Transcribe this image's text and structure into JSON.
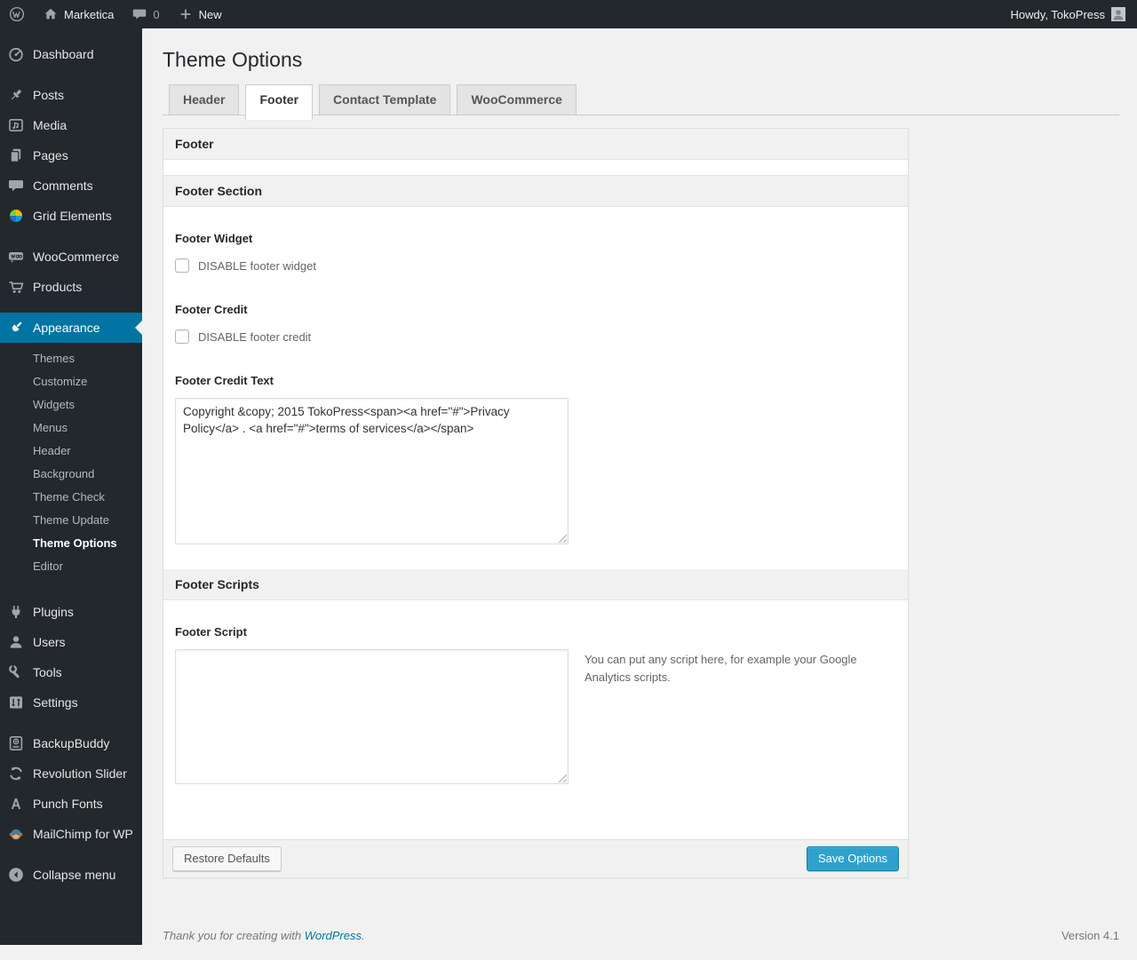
{
  "admin_bar": {
    "site_name": "Marketica",
    "comment_count": "0",
    "new_label": "New",
    "howdy": "Howdy, TokoPress"
  },
  "sidebar": {
    "items": [
      {
        "label": "Dashboard"
      },
      {
        "label": "Posts"
      },
      {
        "label": "Media"
      },
      {
        "label": "Pages"
      },
      {
        "label": "Comments"
      },
      {
        "label": "Grid Elements"
      },
      {
        "label": "WooCommerce"
      },
      {
        "label": "Products"
      },
      {
        "label": "Appearance",
        "active": true
      },
      {
        "label": "Plugins"
      },
      {
        "label": "Users"
      },
      {
        "label": "Tools"
      },
      {
        "label": "Settings"
      },
      {
        "label": "BackupBuddy"
      },
      {
        "label": "Revolution Slider"
      },
      {
        "label": "Punch Fonts"
      },
      {
        "label": "MailChimp for WP"
      },
      {
        "label": "Collapse menu"
      }
    ],
    "appearance_submenu": [
      "Themes",
      "Customize",
      "Widgets",
      "Menus",
      "Header",
      "Background",
      "Theme Check",
      "Theme Update",
      "Theme Options",
      "Editor"
    ],
    "current_submenu": "Theme Options"
  },
  "page": {
    "title": "Theme Options",
    "tabs": [
      {
        "label": "Header"
      },
      {
        "label": "Footer",
        "active": true
      },
      {
        "label": "Contact Template"
      },
      {
        "label": "WooCommerce"
      }
    ],
    "panel": {
      "header_title": "Footer",
      "section1_title": "Footer Section",
      "section2_title": "Footer Scripts",
      "footer_widget_label": "Footer Widget",
      "footer_widget_checkbox": "DISABLE footer widget",
      "footer_credit_label": "Footer Credit",
      "footer_credit_checkbox": "DISABLE footer credit",
      "footer_credit_text_label": "Footer Credit Text",
      "footer_credit_text_value": "Copyright &copy; 2015 TokoPress<span><a href=\"#\">Privacy Policy</a> . <a href=\"#\">terms of services</a></span>",
      "footer_script_label": "Footer Script",
      "footer_script_value": "",
      "footer_script_help": "You can put any script here, for example your Google Analytics scripts.",
      "restore_button": "Restore Defaults",
      "save_button": "Save Options"
    }
  },
  "page_footer": {
    "thanks_prefix": "Thank you for creating with ",
    "wordpress_link": "WordPress",
    "thanks_suffix": ".",
    "version": "Version 4.1"
  },
  "colors": {
    "accent": "#0074a2",
    "primary_button": "#2ea2cc",
    "dark_chrome": "#23282d",
    "page_bg": "#f1f1f1"
  }
}
